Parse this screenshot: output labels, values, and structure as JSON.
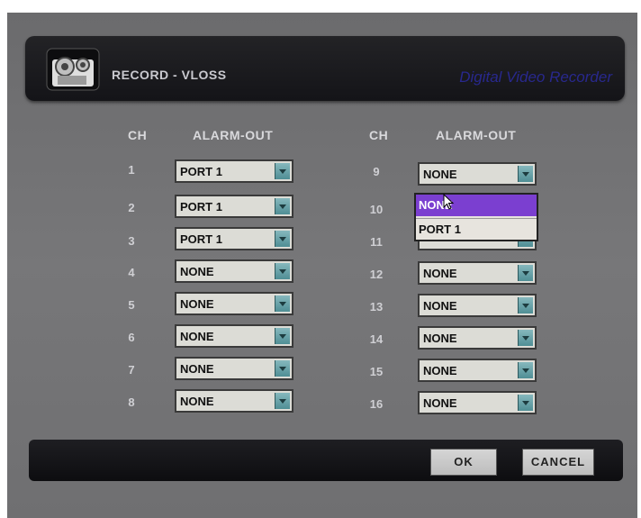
{
  "header": {
    "title": "RECORD - VLOSS",
    "brand": "Digital Video Recorder",
    "icon": "camera-icon"
  },
  "columns": {
    "ch_label": "CH",
    "alarm_label": "ALARM-OUT"
  },
  "left_channels": [
    {
      "ch": "1",
      "value": "PORT 1"
    },
    {
      "ch": "2",
      "value": "PORT 1"
    },
    {
      "ch": "3",
      "value": "PORT 1"
    },
    {
      "ch": "4",
      "value": "NONE"
    },
    {
      "ch": "5",
      "value": "NONE"
    },
    {
      "ch": "6",
      "value": "NONE"
    },
    {
      "ch": "7",
      "value": "NONE"
    },
    {
      "ch": "8",
      "value": "NONE"
    }
  ],
  "right_channels": [
    {
      "ch": "9",
      "value": "NONE"
    },
    {
      "ch": "10",
      "value": ""
    },
    {
      "ch": "11",
      "value": ""
    },
    {
      "ch": "12",
      "value": "NONE"
    },
    {
      "ch": "13",
      "value": "NONE"
    },
    {
      "ch": "14",
      "value": "NONE"
    },
    {
      "ch": "15",
      "value": "NONE"
    },
    {
      "ch": "16",
      "value": "NONE"
    }
  ],
  "popup": {
    "options": [
      "NONE",
      "PORT 1"
    ],
    "selected_index": 0
  },
  "buttons": {
    "ok": "OK",
    "cancel": "CANCEL"
  },
  "colors": {
    "selected_option": "#7b3fd0",
    "dropdown_arrow": "#5f9ea4"
  }
}
